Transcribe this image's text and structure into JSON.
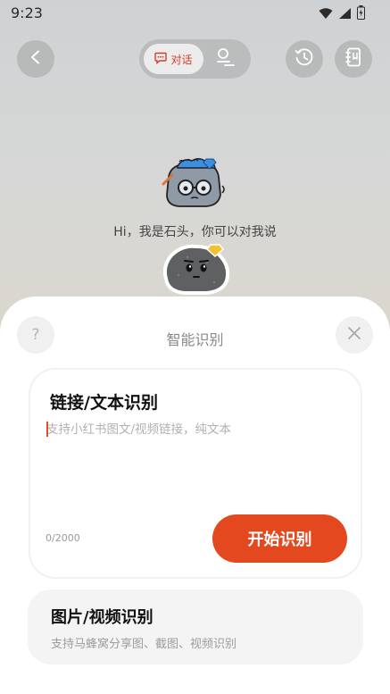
{
  "status_bar": {
    "time": "9:23",
    "icons": [
      "wifi-icon",
      "signal-icon",
      "battery-icon"
    ]
  },
  "top_bar": {
    "back_icon": "chevron-left-icon",
    "tabs": [
      {
        "label": "对话",
        "icon": "chat-icon",
        "active": true
      },
      {
        "label": "",
        "icon": "tool-icon",
        "active": false
      }
    ],
    "history_icon": "history-icon",
    "notebook_icon": "notebook-icon"
  },
  "assistant": {
    "greeting": "Hi，我是石头，你可以对我说"
  },
  "sheet": {
    "title": "智能识别",
    "help_icon_text": "?",
    "close_icon": "close-icon",
    "text_card": {
      "title": "链接/文本识别",
      "value": "",
      "placeholder": "支持小红书图文/视频链接，纯文本",
      "char_count": "0/2000",
      "submit_label": "开始识别"
    },
    "media_card": {
      "title": "图片/视频识别",
      "subtitle": "支持马蜂窝分享图、截图、视频识别"
    }
  },
  "colors": {
    "accent": "#e4481f",
    "active_tab_text": "#d3402a"
  }
}
